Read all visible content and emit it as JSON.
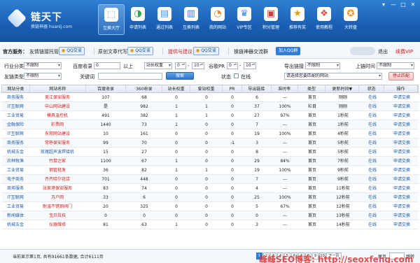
{
  "app": {
    "title": "链天下",
    "subtitle": "换链神器 huanlj.com",
    "window_controls": [
      "▾",
      "—",
      "□",
      "✕"
    ]
  },
  "nav": [
    {
      "label": "互换大厅",
      "icon": "hall-icon",
      "active": true
    },
    {
      "label": "申请列表",
      "icon": "apply-list-icon",
      "active": false
    },
    {
      "label": "通过列表",
      "icon": "passed-list-icon",
      "active": false
    },
    {
      "label": "互换列表",
      "icon": "exchange-list-icon",
      "active": false
    },
    {
      "label": "我的网站",
      "icon": "my-site-icon",
      "active": false
    },
    {
      "label": "VIP专区",
      "icon": "vip-icon",
      "active": false
    },
    {
      "label": "积分管理",
      "icon": "points-icon",
      "active": false
    },
    {
      "label": "推荐有奖",
      "icon": "reward-icon",
      "active": false
    },
    {
      "label": "使用教程",
      "icon": "tutorial-icon",
      "active": false
    },
    {
      "label": "大转盘",
      "icon": "wheel-icon",
      "active": false
    }
  ],
  "service_bar": {
    "label": "官方服务：",
    "items": [
      {
        "text": "友情链接托管",
        "btn": "QQ交谈"
      },
      {
        "text": "原创文章代写",
        "btn": "QQ交谈"
      },
      {
        "text": "提供与建议",
        "btn": "QQ交谈"
      },
      {
        "text": "换链神器交流群",
        "btn": "加入QQ群"
      }
    ],
    "exit": "退出",
    "vip": "续费VIP"
  },
  "filters": {
    "industry_label": "行业分类",
    "industry_value": "不限制",
    "baidu_label": "百度收录",
    "baidu_value": "0",
    "above": "以上",
    "weight_value": "站长权重",
    "spin1": "0",
    "spin_sep": "-",
    "spin2": "10",
    "pr_label": "谷歌PR",
    "pr1": "0",
    "pr2": "10",
    "outlink_label": "导出链接",
    "outlink_value": "不限制",
    "uptime_label": "上链时间",
    "uptime_value": "不限制",
    "friend_label": "友链类型",
    "friend_value": "不限制",
    "keyword_label": "关键词",
    "keyword_value": "",
    "search_btn": "搜索",
    "status_label": "状态",
    "online_label": "在线",
    "match_text": "请选择您要匹配的网站",
    "reset_btn": "停止匹配"
  },
  "table": {
    "headers": [
      "网站分类",
      "网站名称",
      "百度收录",
      "360收录",
      "站长权重",
      "爱站权重",
      "PR",
      "导出链接",
      "准时率",
      "类型",
      "更新时间▼",
      "状态",
      "操作"
    ],
    "rows": [
      [
        "商务服务",
        "美江保安服务",
        "107",
        "68",
        "0",
        "0",
        "0",
        "6",
        "---",
        "首页",
        "刚刚",
        "在线",
        "申请交换"
      ],
      [
        "IT互联网",
        "中山网站建设",
        "是",
        "982",
        "1",
        "1",
        "0",
        "37",
        "100%",
        "栏目",
        "刚刚",
        "在线",
        "申请交换"
      ],
      [
        "工业贸易",
        "模具温控机",
        "491",
        "382",
        "1",
        "1",
        "0",
        "27",
        "97%",
        "首页",
        "1秒前",
        "在线",
        "申请交换"
      ],
      [
        "金融保险",
        "彩票网",
        "1440",
        "73",
        "1",
        "0",
        "0",
        "7",
        "---",
        "首页",
        "1秒前",
        "在线",
        "申请交换"
      ],
      [
        "IT互联网",
        "东莞网站建设",
        "10",
        "161",
        "0",
        "0",
        "0",
        "19",
        "100%",
        "首页",
        "4秒前",
        "在线",
        "申请交换"
      ],
      [
        "商务服务",
        "常熟保安服务",
        "99",
        "70",
        "0",
        "0",
        "-1",
        "3",
        "---",
        "首页",
        "5秒前",
        "在线",
        "申请交换"
      ],
      [
        "机械五金",
        "玫瑰超声波焊接机",
        "15",
        "27",
        "0",
        "0",
        "0",
        "8",
        "---",
        "首页",
        "5秒前",
        "在线",
        "申请交换"
      ],
      [
        "农林牧渔",
        "竹鼠之家",
        "1100",
        "67",
        "1",
        "0",
        "0",
        "29",
        "84%",
        "首页",
        "7秒前",
        "在线",
        "申请交换"
      ],
      [
        "工业贸易",
        "钢管批发",
        "36",
        "82",
        "1",
        "1",
        "0",
        "19",
        "100%",
        "首页",
        "9秒前",
        "在线",
        "申请交换"
      ],
      [
        "电子商务",
        "齐齐哈尔花店",
        "701",
        "448",
        "0",
        "0",
        "0",
        "7",
        "---",
        "首页",
        "9秒前",
        "在线",
        "申请交换"
      ],
      [
        "商务服务",
        "张家港保安服务",
        "83",
        "74",
        "0",
        "0",
        "0",
        "4",
        "---",
        "首页",
        "11秒前",
        "在线",
        "申请交换"
      ],
      [
        "IT互联网",
        "万户网",
        "33",
        "6",
        "0",
        "0",
        "0",
        "25",
        "100%",
        "首页",
        "12秒前",
        "在线",
        "申请交换"
      ],
      [
        "工业贸易",
        "耐温不锈钢阀门",
        "20",
        "325",
        "0",
        "0",
        "0",
        "5",
        "67%",
        "首页",
        "12秒前",
        "在线",
        "申请交换"
      ],
      [
        "新闻媒体",
        "宝贝炫技",
        "0",
        "0",
        "0",
        "0",
        "0",
        "0",
        "---",
        "首页",
        "13秒前",
        "在线",
        "申请交换"
      ],
      [
        "机械五金",
        "仪器维修",
        "81",
        "63",
        "1",
        "0",
        "0",
        "3",
        "---",
        "首页",
        "14秒前",
        "在线",
        "申请交换"
      ]
    ]
  },
  "footer": {
    "info": "当前显示第1页, 共有91661条数据, 合计6111页",
    "pages": [
      "1",
      "2",
      "3",
      "4",
      "5",
      "6",
      "7",
      "8",
      "9",
      "10"
    ],
    "next": "下一页",
    "last": "尾页",
    "jump": "跳转"
  },
  "watermark": "峰峰SEO博客: http://seoxfeng.com"
}
